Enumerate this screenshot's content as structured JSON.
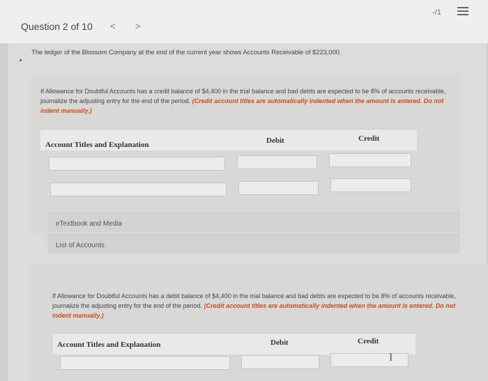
{
  "header": {
    "question_label": "Question 2 of 10",
    "prev": "<",
    "next": ">",
    "score": "-/1",
    "menu_icon": "list-icon"
  },
  "stem": "The ledger of the Blossom Company at the end of the current year shows Accounts Receivable of $223,000.",
  "part1": {
    "text": "If Allowance for Doubtful Accounts has a credit balance of $4,400 in the trial balance and bad debts are expected to be 8% of accounts receivable, journalize the adjusting entry for the end of the period.",
    "instruction": "(Credit account titles are automatically indented when the amount is entered. Do not indent manually.)",
    "columns": {
      "account": "Account Titles and Explanation",
      "debit": "Debit",
      "credit": "Credit"
    },
    "rows": [
      {
        "account": "",
        "debit": "",
        "credit": ""
      },
      {
        "account": "",
        "debit": "",
        "credit": ""
      }
    ]
  },
  "links": {
    "etextbook": "eTextbook and Media",
    "accounts": "List of Accounts"
  },
  "part2": {
    "text": "If Allowance for Doubtful Accounts has a debit balance of $4,400 in the trial balance and bad debts are expected to be 8% of accounts receivable, journalize the adjusting entry for the end of the period.",
    "instruction": "(Credit account titles are automatically indented when the amount is entered. Do not indent manually.)",
    "columns": {
      "account": "Account Titles and Explanation",
      "debit": "Debit",
      "credit": "Credit"
    },
    "rows": [
      {
        "account": "",
        "debit": "",
        "credit": ""
      }
    ]
  },
  "colors": {
    "instruction": "#cf4a1a",
    "background": "#cfcfcd"
  }
}
